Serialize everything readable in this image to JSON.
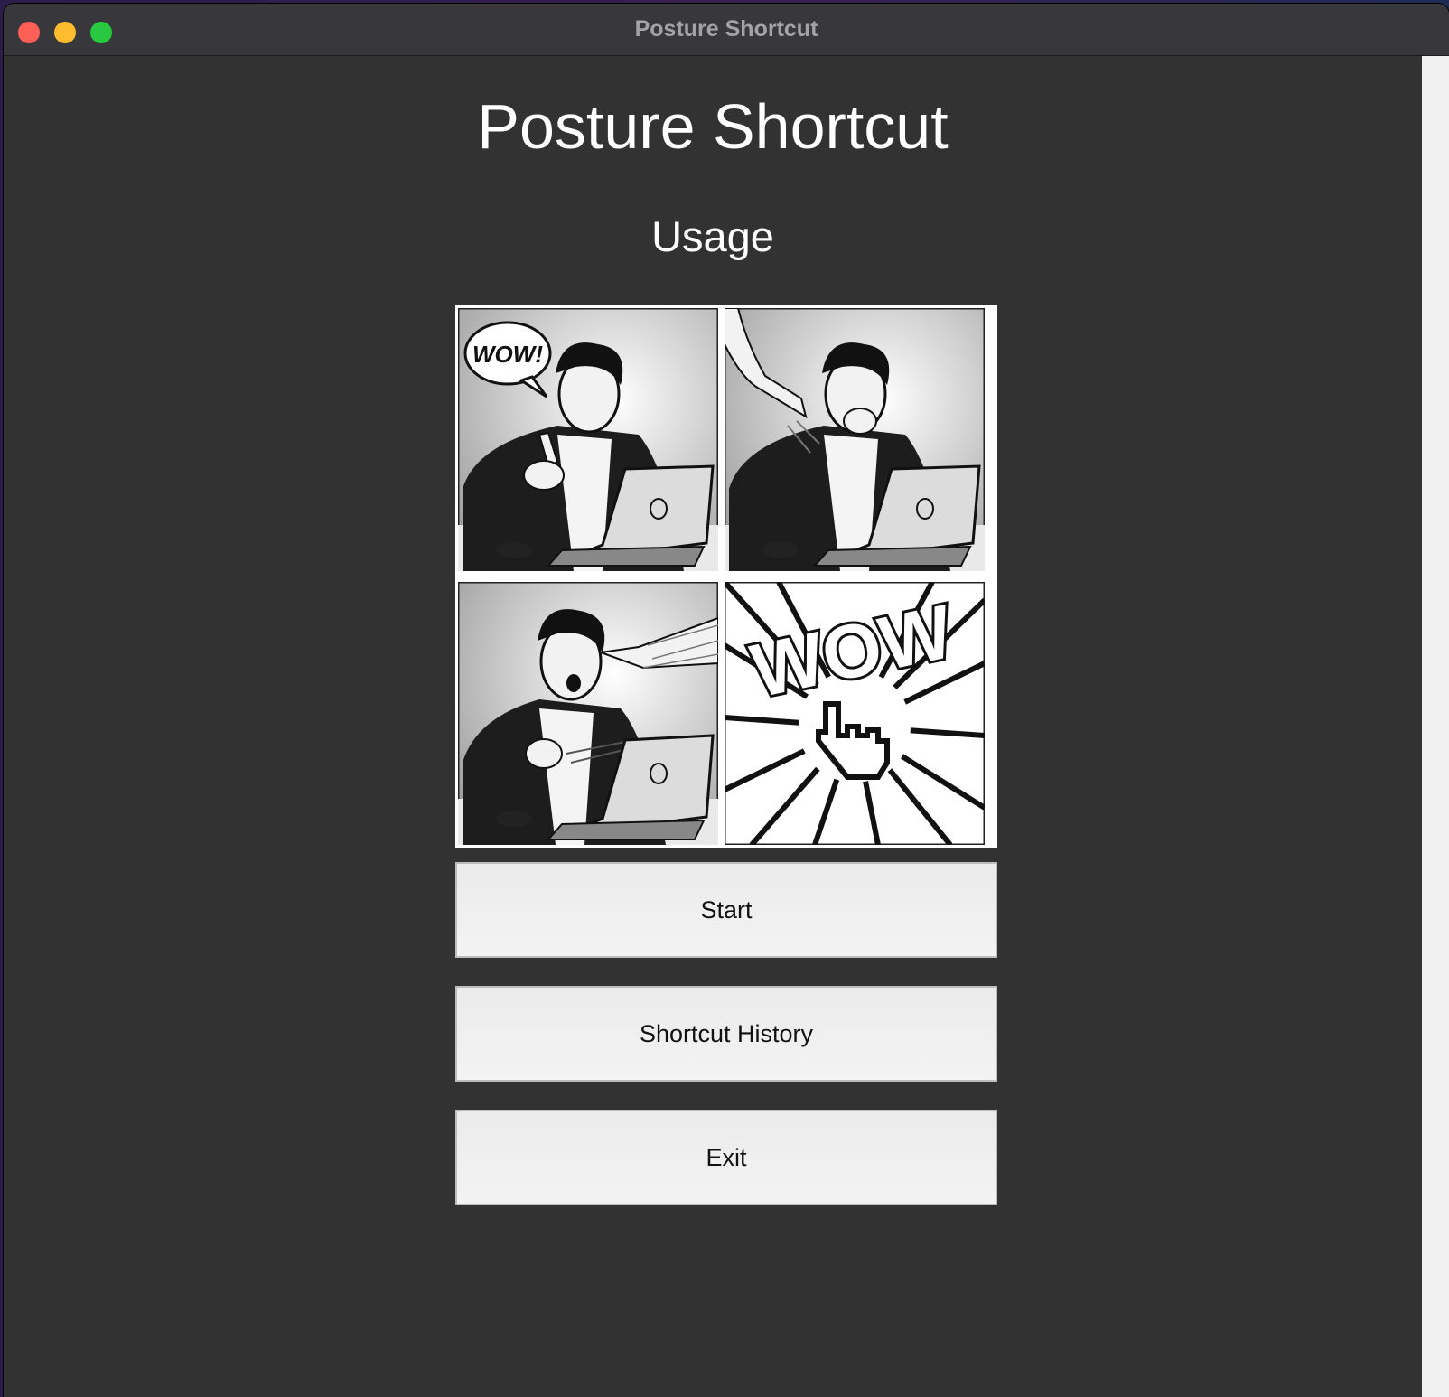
{
  "window": {
    "title": "Posture Shortcut"
  },
  "header": {
    "title": "Posture Shortcut",
    "subtitle": "Usage"
  },
  "comic": {
    "speech_bubble": "WOW!",
    "burst_text": "WOW"
  },
  "buttons": {
    "start": "Start",
    "history": "Shortcut History",
    "exit": "Exit"
  }
}
